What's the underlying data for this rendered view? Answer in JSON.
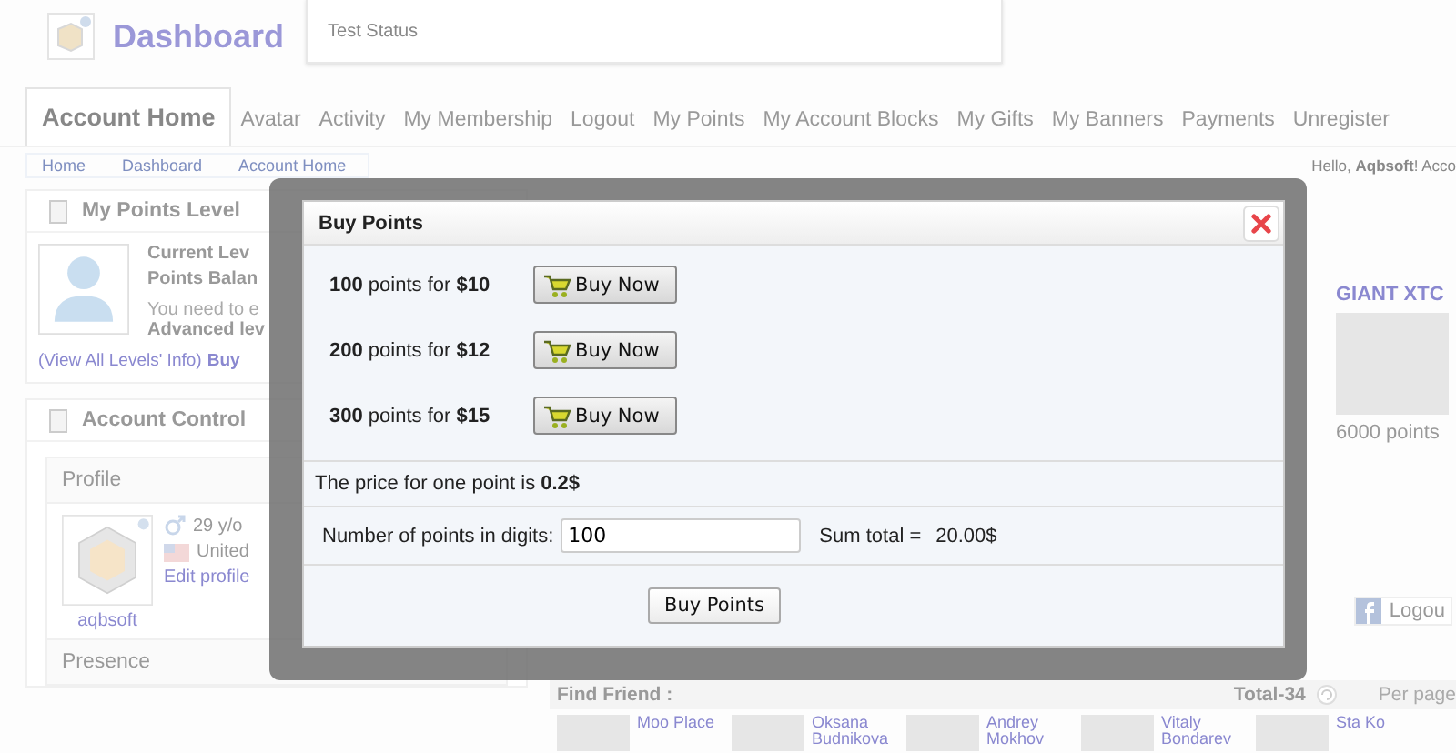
{
  "header": {
    "title": "Dashboard",
    "status": "Test Status"
  },
  "nav": [
    {
      "label": "Account Home",
      "selected": true
    },
    {
      "label": "Avatar",
      "selected": false
    },
    {
      "label": "Activity",
      "selected": false
    },
    {
      "label": "My Membership",
      "selected": false
    },
    {
      "label": "Logout",
      "selected": false
    },
    {
      "label": "My Points",
      "selected": false
    },
    {
      "label": "My Account Blocks",
      "selected": false
    },
    {
      "label": "My Gifts",
      "selected": false
    },
    {
      "label": "My Banners",
      "selected": false
    },
    {
      "label": "Payments",
      "selected": false
    },
    {
      "label": "Unregister",
      "selected": false
    }
  ],
  "breadcrumb": [
    "Home",
    "Dashboard",
    "Account Home"
  ],
  "greeting": "Hello, **Aqbsoft**! Acco",
  "points_panel": {
    "title": "My Points Level",
    "current_level": "Current Lev",
    "points_balance": "Points Balan",
    "note_1": "You need to e",
    "note_2": "Advanced lev",
    "levels_link": "(View All Levels' Info)",
    "buy_link": "Buy"
  },
  "account_panel": {
    "title": "Account Control",
    "profile_title": "Profile",
    "age": "29 y/o",
    "country": "United",
    "edit_link": "Edit profile",
    "username": "aqbsoft",
    "presence": "Presence"
  },
  "product": {
    "name": "GIANT XTC",
    "price": "6000 points"
  },
  "facebook_button": "Logou",
  "find_friend": {
    "title": "Find Friend :",
    "total": "Total-34",
    "per_page": "Per page"
  },
  "friends": [
    {
      "name": "Moo Place"
    },
    {
      "name": "Oksana Budnikova"
    },
    {
      "name": "Andrey Mokhov"
    },
    {
      "name": "Vitaly Bondarev"
    },
    {
      "name": "Sta Ko"
    }
  ],
  "modal": {
    "title": "Buy Points",
    "offers": [
      {
        "text": "**100** points for **$10**",
        "button": "Buy Now"
      },
      {
        "text": "**200** points for **$12**",
        "button": "Buy Now"
      },
      {
        "text": "**300** points for **$15**",
        "button": "Buy Now"
      }
    ],
    "price_note": "The price for one point is **0.2$**",
    "amount_label": "Number of points in digits:",
    "amount_value": "100",
    "sum_label": "Sum total =",
    "sum_value": "20.00$",
    "submit": "Buy Points"
  }
}
